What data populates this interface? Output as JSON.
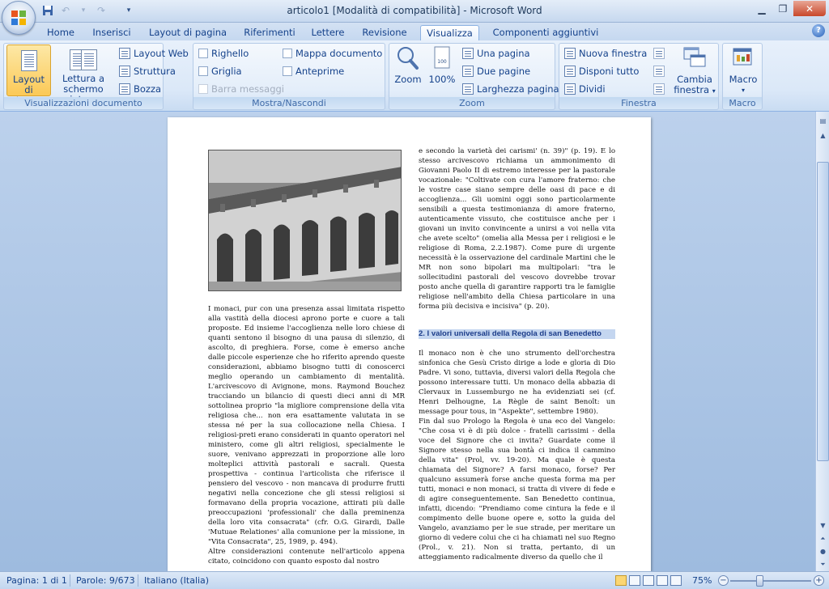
{
  "title_bar": {
    "title": "articolo1 [Modalità di compatibilità] - Microsoft Word",
    "qat_icons": [
      "save-icon",
      "undo-icon",
      "redo-icon",
      "customize-icon"
    ]
  },
  "tabs": [
    {
      "label": "Home",
      "active": false
    },
    {
      "label": "Inserisci",
      "active": false
    },
    {
      "label": "Layout di pagina",
      "active": false
    },
    {
      "label": "Riferimenti",
      "active": false
    },
    {
      "label": "Lettere",
      "active": false
    },
    {
      "label": "Revisione",
      "active": false
    },
    {
      "label": "Visualizza",
      "active": true
    },
    {
      "label": "Componenti aggiuntivi",
      "active": false
    }
  ],
  "ribbon": {
    "views": {
      "label": "Visualizzazioni documento",
      "print_layout": "Layout di stampa",
      "full_screen_1": "Lettura a",
      "full_screen_2": "schermo intero",
      "web_layout": "Layout Web",
      "outline": "Struttura",
      "draft": "Bozza"
    },
    "show_hide": {
      "label": "Mostra/Nascondi",
      "ruler": "Righello",
      "gridlines": "Griglia",
      "message_bar": "Barra messaggi",
      "document_map": "Mappa documento",
      "thumbnails": "Anteprime"
    },
    "zoom": {
      "label": "Zoom",
      "zoom": "Zoom",
      "hundred": "100%",
      "one_page": "Una pagina",
      "two_pages": "Due pagine",
      "page_width": "Larghezza pagina"
    },
    "window": {
      "label": "Finestra",
      "new_window": "Nuova finestra",
      "arrange_all": "Disponi tutto",
      "split": "Dividi",
      "switch_1": "Cambia",
      "switch_2": "finestra"
    },
    "macro": {
      "label": "Macro",
      "macro": "Macro"
    }
  },
  "document": {
    "left_column": [
      "I monaci, pur con una presenza assai limitata rispetto alla vastità della diocesi aprono porte e cuore a tali proposte. Ed insieme l'accoglienza nelle loro chiese di quanti sentono il bisogno di una pausa di silenzio, di ascolto, di preghiera. Forse, come è emerso anche dalle piccole esperienze che ho riferito aprendo queste considerazioni, abbiamo bisogno tutti di conoscerci meglio operando un cambiamento di mentalità. L'arcivescovo di Avignone, mons. Raymond Bouchez tracciando un bilancio di questi dieci anni di MR sottolinea proprio \"la migliore comprensione della vita religiosa che... non era esattamente valutata in se stessa né per la sua collocazione nella Chiesa. I religiosi-preti erano considerati in quanto operatori nel ministero, come gli altri religiosi, specialmente le suore, venivano apprezzati in proporzione alle loro molteplici attività pastorali e sacrali. Questa prospettiva - continua l'articolista che riferisce il pensiero del vescovo - non mancava di produrre frutti negativi nella concezione che gli stessi religiosi si formavano della propria vocazione, attirati più dalle preoccupazioni 'professionali' che dalla preminenza della loro vita consacrata\" (cfr. O.G. Girardi, Dalle 'Mutuae Relationes' alla comunione per la missione, in \"Vita Consacrata\", 25, 1989, p. 494).",
      "Altre considerazioni contenute nell'articolo appena citato, coincidono con quanto esposto dal nostro"
    ],
    "right_column_top": "e secondo la varietà dei carismi' (n. 39)\" (p. 19). E lo stesso arcivescovo richiama un ammonimento di Giovanni Paolo II di estremo interesse per la pastorale vocazionale: \"Coltivate con cura l'amore fraterno: che le vostre case siano sempre delle oasi di pace e di accoglienza... Gli uomini oggi sono particolarmente sensibili a questa testimonianza di amore fraterno, autenticamente vissuto, che costituisce anche per i giovani un invito convincente a unirsi a voi nella vita che avete scelto\" (omelia alla Messa per i religiosi e le religiose di Roma, 2.2.1987). Come pure di urgente necessità è la osservazione del cardinale Martini che le MR non sono bipolari ma multipolari: \"tra le sollecitudini pastorali del vescovo dovrebbe trovar posto anche quella di garantire rapporti tra le famiglie religiose nell'ambito della Chiesa particolare in una forma più decisiva e incisiva\" (p. 20).",
    "heading": "2. I valori universali della Regola di san Benedetto",
    "right_column_p1": "Il monaco non è che uno strumento dell'orchestra sinfonica che Gesù Cristo dirige a lode e gloria di Dio Padre. Vi sono, tuttavia, diversi valori della Regola che possono interessare tutti. Un monaco della abbazia di Clervaux in Lussemburgo ne ha evidenziati sei (cf. Henri Delhougne, La Règle de saint Benoît: un message pour tous, in \"Aspekte\", settembre 1980).",
    "right_column_p2": "Fin dal suo Prologo la Regola è una eco del Vangelo: \"Che cosa vi è di più dolce - fratelli carissimi - della voce del Signore che ci invita? Guardate come il Signore stesso nella sua bontà ci indica il cammino della vita\" (Prol, vv. 19-20). Ma quale è questa chiamata del Signore? A farsi monaco, forse? Per qualcuno assumerà forse anche questa forma ma per tutti, monaci e non monaci, si tratta di vivere di fede e di agire conseguentemente. San Benedetto continua, infatti, dicendo: \"Prendiamo come cintura la fede e il compimento delle buone opere e, sotto la guida del Vangelo, avanziamo per le sue strade, per meritare un giorno di vedere colui che ci ha chiamati nel suo Regno (Prol., v. 21). Non si tratta, pertanto, di un atteggiamento radicalmente diverso da quello che il"
  },
  "status_bar": {
    "page": "Pagina: 1 di 1",
    "words": "Parole: 9/673",
    "language": "Italiano (Italia)",
    "zoom": "75%"
  }
}
